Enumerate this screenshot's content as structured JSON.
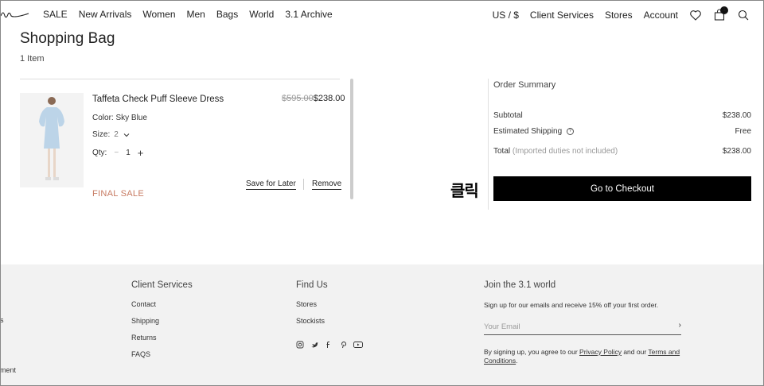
{
  "nav": {
    "left": [
      "SALE",
      "New Arrivals",
      "Women",
      "Men",
      "Bags",
      "World",
      "3.1 Archive"
    ],
    "right": [
      "US / $",
      "Client Services",
      "Stores",
      "Account"
    ],
    "bag_count": "1"
  },
  "bag": {
    "title": "Shopping Bag",
    "item_count": "1 Item"
  },
  "item": {
    "name": "Taffeta Check Puff Sleeve Dress",
    "old_price": "$595.00",
    "new_price": "$238.00",
    "color": "Color: Sky Blue",
    "size_label": "Size:",
    "size_value": "2",
    "qty_label": "Qty:",
    "qty_minus": "−",
    "qty_value": "1",
    "qty_plus": "+",
    "final_sale": "FINAL SALE",
    "save_for_later": "Save for Later",
    "remove": "Remove"
  },
  "summary": {
    "title": "Order Summary",
    "subtotal_label": "Subtotal",
    "subtotal_value": "$238.00",
    "shipping_label": "Estimated Shipping",
    "shipping_value": "Free",
    "total_label": "Total",
    "total_note": "(Imported duties not included)",
    "total_value": "$238.00",
    "checkout": "Go to Checkout"
  },
  "annotation": "클릭",
  "footer": {
    "client_services": {
      "title": "Client Services",
      "links": [
        "Contact",
        "Shipping",
        "Returns",
        "FAQS"
      ]
    },
    "find_us": {
      "title": "Find Us",
      "links": [
        "Stores",
        "Stockists"
      ]
    },
    "join": {
      "title": "Join the 3.1 world",
      "text": "Sign up for our emails and receive 15% off your first order.",
      "email_placeholder": "Your Email",
      "legal_a": "By signing up, you agree to our",
      "privacy": "Privacy Policy",
      "legal_b": "and our",
      "terms": "Terms and Conditions",
      "legal_c": "."
    },
    "edge_s": "s",
    "edge_ment": "ment"
  },
  "colors": {
    "final_sale": "#c77b63",
    "checkout_bg": "#000000",
    "footer_bg": "#f2f2f2"
  }
}
